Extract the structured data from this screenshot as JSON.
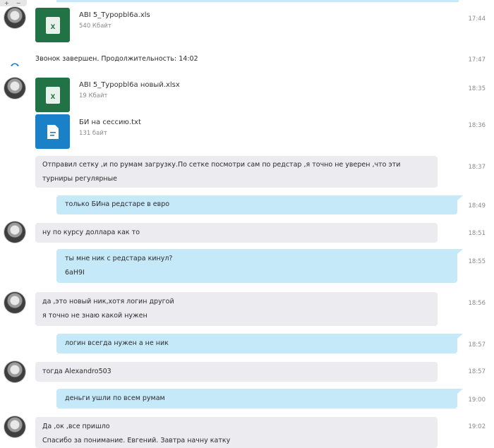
{
  "top_controls": {
    "zoom_in": "+",
    "zoom_out": "−"
  },
  "messages": [
    {
      "type": "file",
      "kind": "xls",
      "name": "ABI 5_Турорbl6a.xls",
      "size": "540 Кбайт",
      "time": "17:44"
    },
    {
      "type": "system",
      "text": "Звонок завершен. Продолжительность: 14:02",
      "time": "17:47"
    },
    {
      "type": "file",
      "kind": "xls",
      "name": "ABI 5_Турорbl6a новый.xlsx",
      "size": "19 Кбайт",
      "time": "18:35"
    },
    {
      "type": "file",
      "kind": "txt",
      "name": "БИ на сессию.txt",
      "size": "131 байт",
      "time": "18:36"
    },
    {
      "type": "in",
      "lines": [
        "Отправил сетку ,и по румам загрузку.По сетке посмотри сам по редстар ,я точно не уверен ,что эти",
        "турниры регулярные"
      ],
      "time": "18:37"
    },
    {
      "type": "out",
      "lines": [
        "только БИна редстаре в евро"
      ],
      "time": "18:49"
    },
    {
      "type": "in",
      "lines": [
        "ну по курсу доллара как то"
      ],
      "time": "18:51"
    },
    {
      "type": "out",
      "lines": [
        "ты мне ник с редстара кинул?",
        "6aH9I"
      ],
      "time": "18:55"
    },
    {
      "type": "in",
      "lines": [
        "да ,это новый ник,хотя логин другой",
        "я точно не знаю какой нужен"
      ],
      "time": "18:56"
    },
    {
      "type": "out",
      "lines": [
        "логин всегда нужен а не ник"
      ],
      "time": "18:57"
    },
    {
      "type": "in",
      "lines": [
        "тогда  Alexandro503"
      ],
      "time": "18:57"
    },
    {
      "type": "out",
      "lines": [
        "деньги ушли по всем румам"
      ],
      "time": "19:00"
    },
    {
      "type": "in",
      "lines": [
        "Да ,ок ,все пришло",
        "Спасибо за понимание. Евгений. Завтра начну катку"
      ],
      "time": "19:02"
    }
  ]
}
